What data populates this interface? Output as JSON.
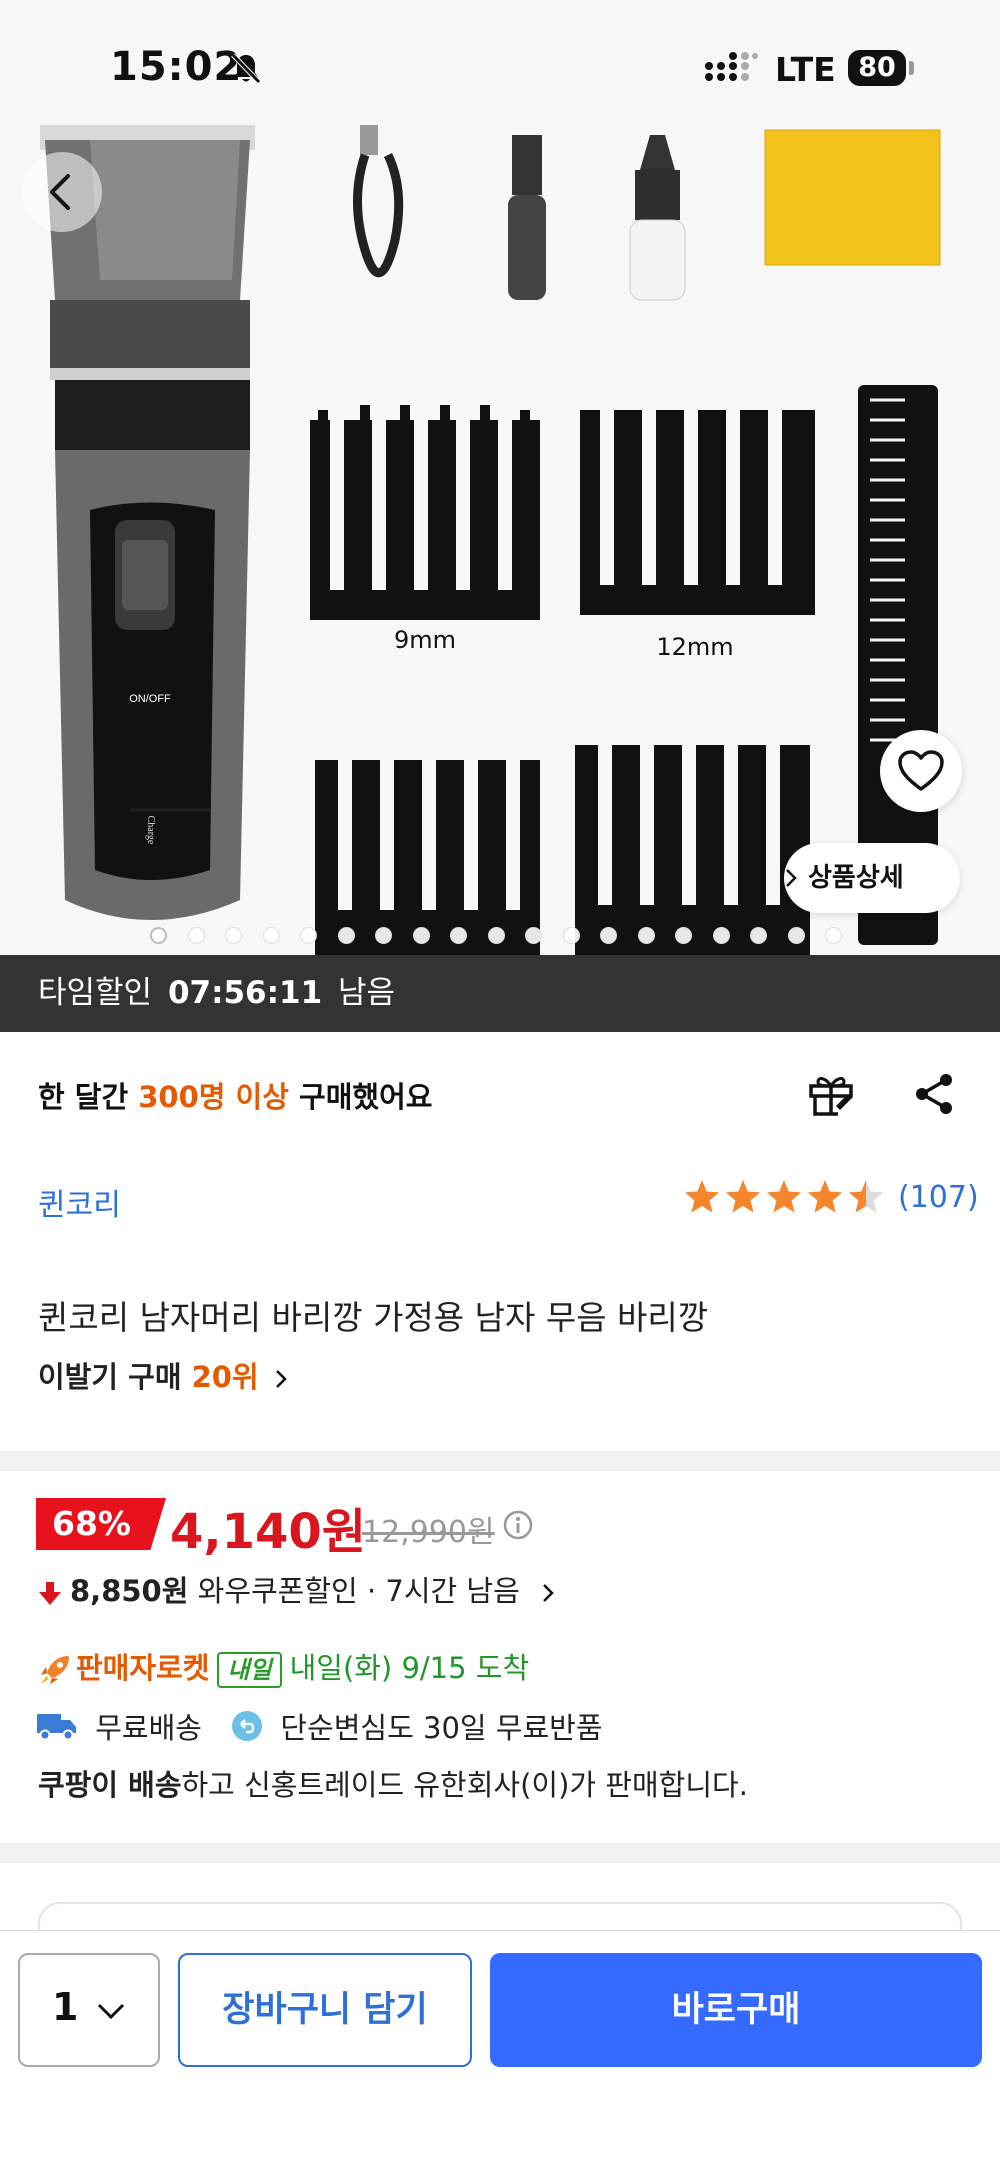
{
  "status_bar": {
    "time": "15:02",
    "network": "LTE",
    "battery": "80"
  },
  "hero": {
    "detail_button_label": "상품상세",
    "comb_labels": [
      "9mm",
      "12mm"
    ],
    "clipper_labels": [
      "ON/OFF",
      "Charge"
    ],
    "active_image": 1,
    "image_count": 19
  },
  "timer": {
    "prefix": "타임할인",
    "time": "07:56:11",
    "suffix": "남음"
  },
  "purchase": {
    "prefix": "한 달간",
    "count": "300명 이상",
    "suffix": "구매했어요"
  },
  "brand": "퀸코리",
  "rating": {
    "stars": 4.5,
    "count": "(107)"
  },
  "product": {
    "title": "퀸코리 남자머리 바리깡 가정용 남자 무음 바리깡",
    "rank_prefix": "이발기 구매",
    "rank_value": "20위"
  },
  "price": {
    "discount": "68%",
    "sale": "4,140원",
    "original": "12,990원",
    "coupon_amount": "8,850원",
    "coupon_label": "와우쿠폰할인 · 7시간 남음"
  },
  "delivery": {
    "rocket_label": "판매자로켓",
    "badge": "내일",
    "eta": "내일(화) 9/15 도착",
    "free_shipping": "무료배송",
    "free_return": "단순변심도 30일 무료반품",
    "seller_bold": "쿠팡이 배송",
    "seller_rest": "하고 신홍트레이드 유한회사(이)가 판매합니다."
  },
  "bottom": {
    "quantity": "1",
    "cart_label": "장바구니 담기",
    "buy_label": "바로구매"
  },
  "colors": {
    "accent_blue": "#346aff",
    "sale_red": "#e8121c",
    "orange": "#e45a00",
    "green": "#22962a",
    "star": "#f5862c"
  }
}
